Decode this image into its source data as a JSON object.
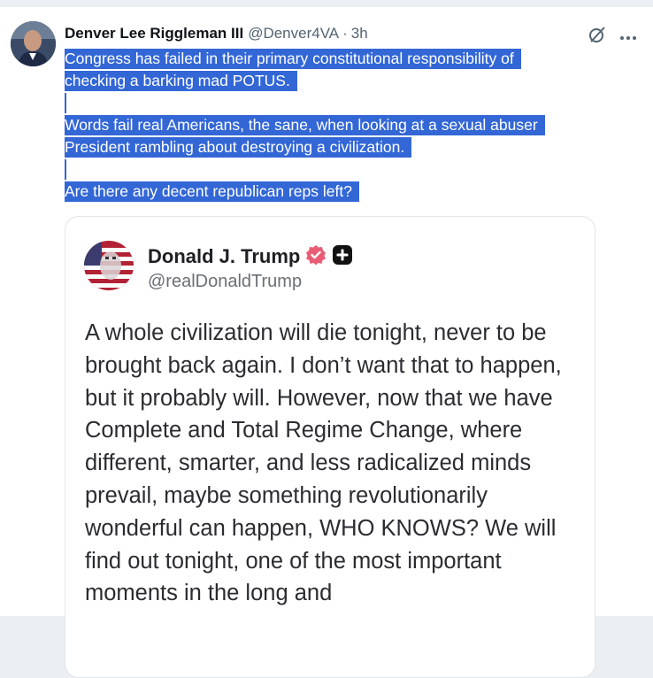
{
  "tweet": {
    "author_name": "Denver Lee Riggleman III",
    "author_handle": "@Denver4VA",
    "separator": "·",
    "time": "3h",
    "paragraphs": [
      [
        "Congress has failed in their primary constitutional responsibility of",
        "checking a barking mad POTUS."
      ],
      [
        "Words fail real Americans, the sane, when looking at a sexual abuser",
        "President rambling about destroying a civilization."
      ],
      [
        "Are there any decent republican reps left?"
      ]
    ],
    "selection_color": "#3367d6",
    "icons": {
      "grok": "grok-icon",
      "more": "more-options-icon"
    }
  },
  "quoted": {
    "name": "Donald J. Trump",
    "handle": "@realDonaldTrump",
    "badge_color": "#e0245e",
    "text": "A whole civilization will die tonight, never to be brought back again. I don’t want that to happen, but it probably will. However, now that we have Complete and Total Regime Change, where different, smarter, and less radicalized minds prevail, maybe something revolutionarily wonderful can happen, WHO KNOWS? We will find out tonight, one of the most important moments in the long and"
  }
}
